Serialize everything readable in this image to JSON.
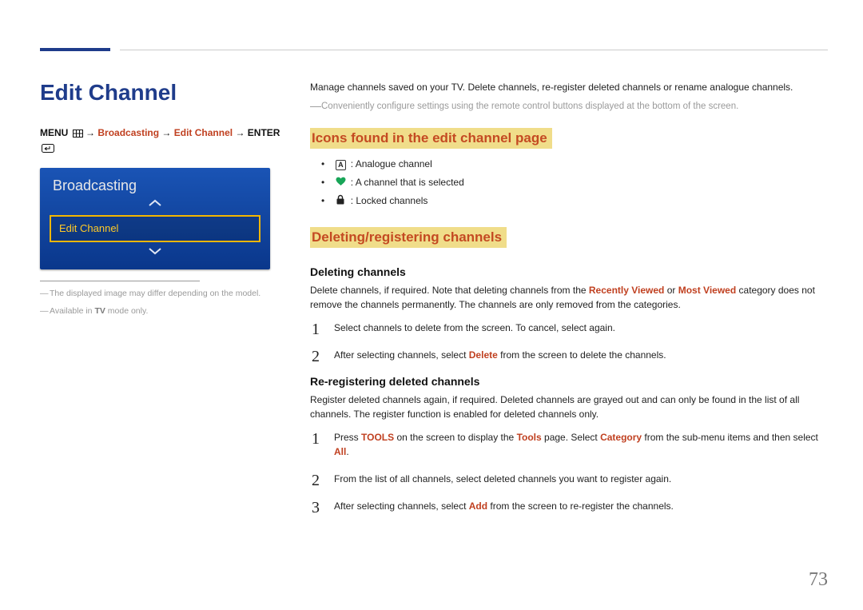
{
  "page": {
    "title": "Edit Channel",
    "page_number": "73"
  },
  "breadcrumb": {
    "menu_label": "MENU",
    "items": [
      "Broadcasting",
      "Edit Channel"
    ],
    "enter_label": "ENTER",
    "arrow": "→"
  },
  "tv_panel": {
    "title": "Broadcasting",
    "selected": "Edit Channel"
  },
  "notes": {
    "n1_pre": "The displayed image may differ depending on the model.",
    "n2_pre": "Available in ",
    "n2_bold": "TV",
    "n2_post": " mode only."
  },
  "intro": {
    "line1": "Manage channels saved on your TV. Delete channels, re-register deleted channels or rename analogue channels.",
    "line2": "Conveniently configure settings using the remote control buttons displayed at the bottom of the screen."
  },
  "sections": {
    "icons_heading": "Icons found in the edit channel page",
    "icons": {
      "a_letter": "A",
      "a_text": ": Analogue channel",
      "heart_text": ": A channel that is selected",
      "lock_text": ": Locked channels"
    },
    "delreg_heading": "Deleting/registering channels",
    "deleting": {
      "subhead": "Deleting channels",
      "para_pre": "Delete channels, if required. Note that deleting channels from the ",
      "hl1": "Recently Viewed",
      "mid": " or ",
      "hl2": "Most Viewed",
      "para_post": " category does not remove the channels permanently. The channels are only removed from the categories.",
      "s1": "Select channels to delete from the screen. To cancel, select again.",
      "s2_pre": "After selecting channels, select ",
      "s2_hl": "Delete",
      "s2_post": " from the screen to delete the channels."
    },
    "rereg": {
      "subhead": "Re-registering deleted channels",
      "para": "Register deleted channels again, if required. Deleted channels are grayed out and can only be found in the list of all channels. The register function is enabled for deleted channels only.",
      "s1_pre": "Press ",
      "s1_hl1": "TOOLS",
      "s1_mid1": " on the screen to display the ",
      "s1_hl2": "Tools",
      "s1_mid2": " page. Select ",
      "s1_hl3": "Category",
      "s1_mid3": " from the sub-menu items and then select ",
      "s1_hl4": "All",
      "s1_post": ".",
      "s2": "From the list of all channels, select deleted channels you want to register again.",
      "s3_pre": "After selecting channels, select ",
      "s3_hl": "Add",
      "s3_post": " from the screen to re-register the channels."
    }
  }
}
